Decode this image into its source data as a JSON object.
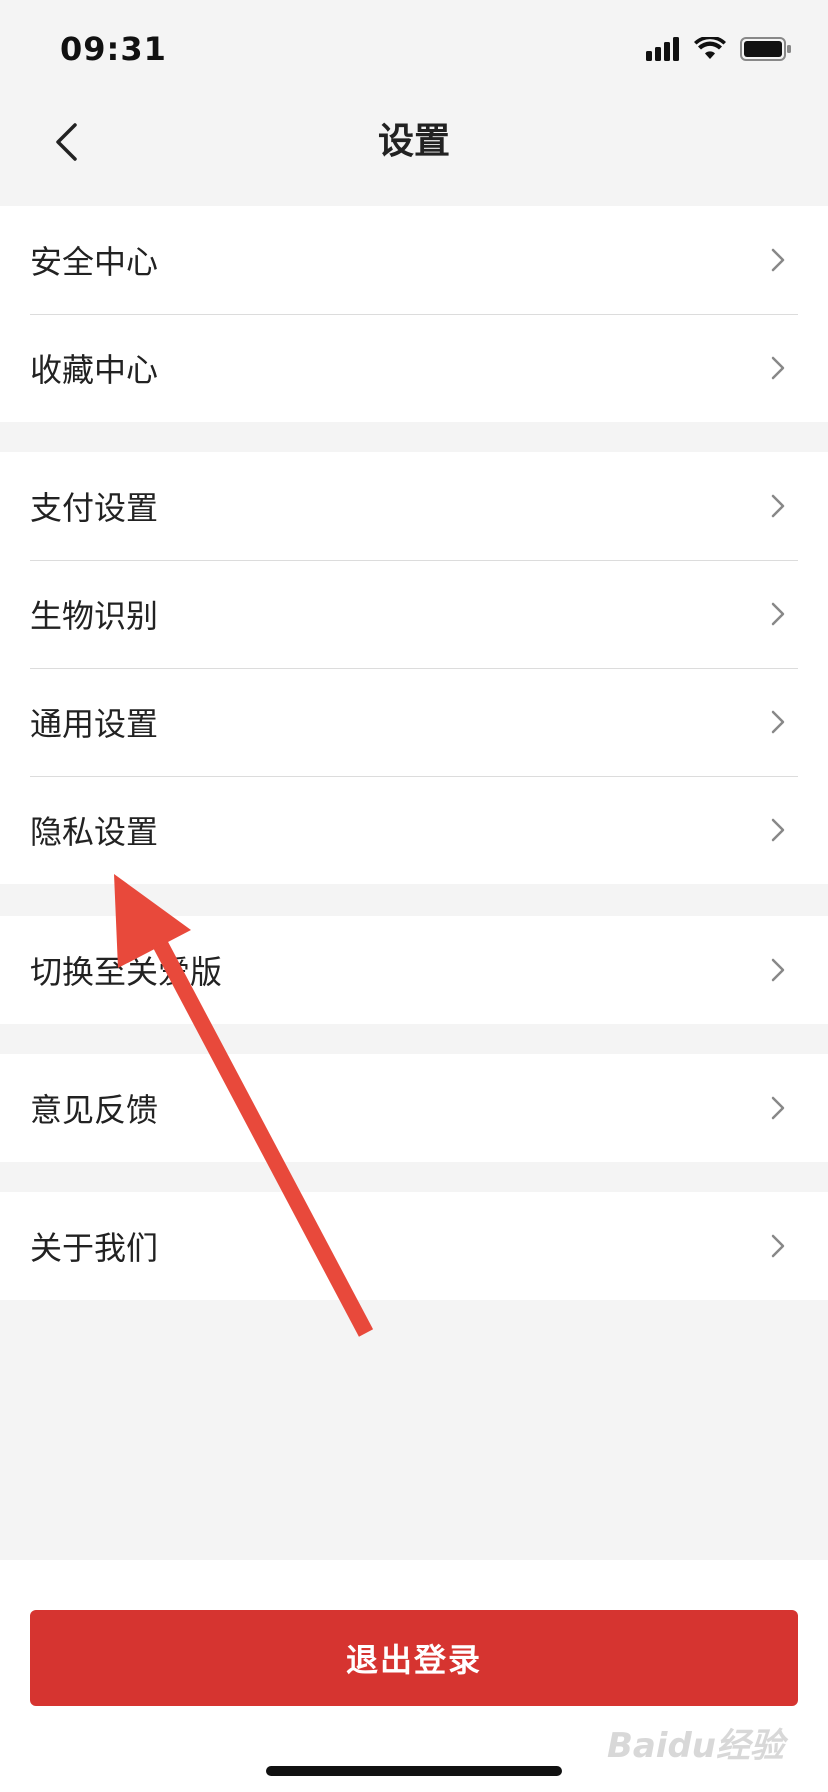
{
  "status_bar": {
    "time": "09:31",
    "icons": [
      "signal-icon",
      "wifi-icon",
      "battery-icon"
    ]
  },
  "nav": {
    "title": "设置",
    "back_icon": "chevron-left-icon"
  },
  "groups": [
    {
      "items": [
        {
          "label": "安全中心"
        },
        {
          "label": "收藏中心"
        }
      ]
    },
    {
      "items": [
        {
          "label": "支付设置"
        },
        {
          "label": "生物识别"
        },
        {
          "label": "通用设置"
        },
        {
          "label": "隐私设置"
        }
      ]
    },
    {
      "items": [
        {
          "label": "切换至关爱版"
        }
      ]
    },
    {
      "items": [
        {
          "label": "意见反馈"
        }
      ]
    },
    {
      "items": [
        {
          "label": "关于我们"
        }
      ]
    }
  ],
  "logout": {
    "label": "退出登录"
  },
  "watermark": {
    "text": "Baidu经验"
  },
  "colors": {
    "accent": "#d63430",
    "annotation_arrow": "#e8493b",
    "background": "#f4f4f4"
  }
}
